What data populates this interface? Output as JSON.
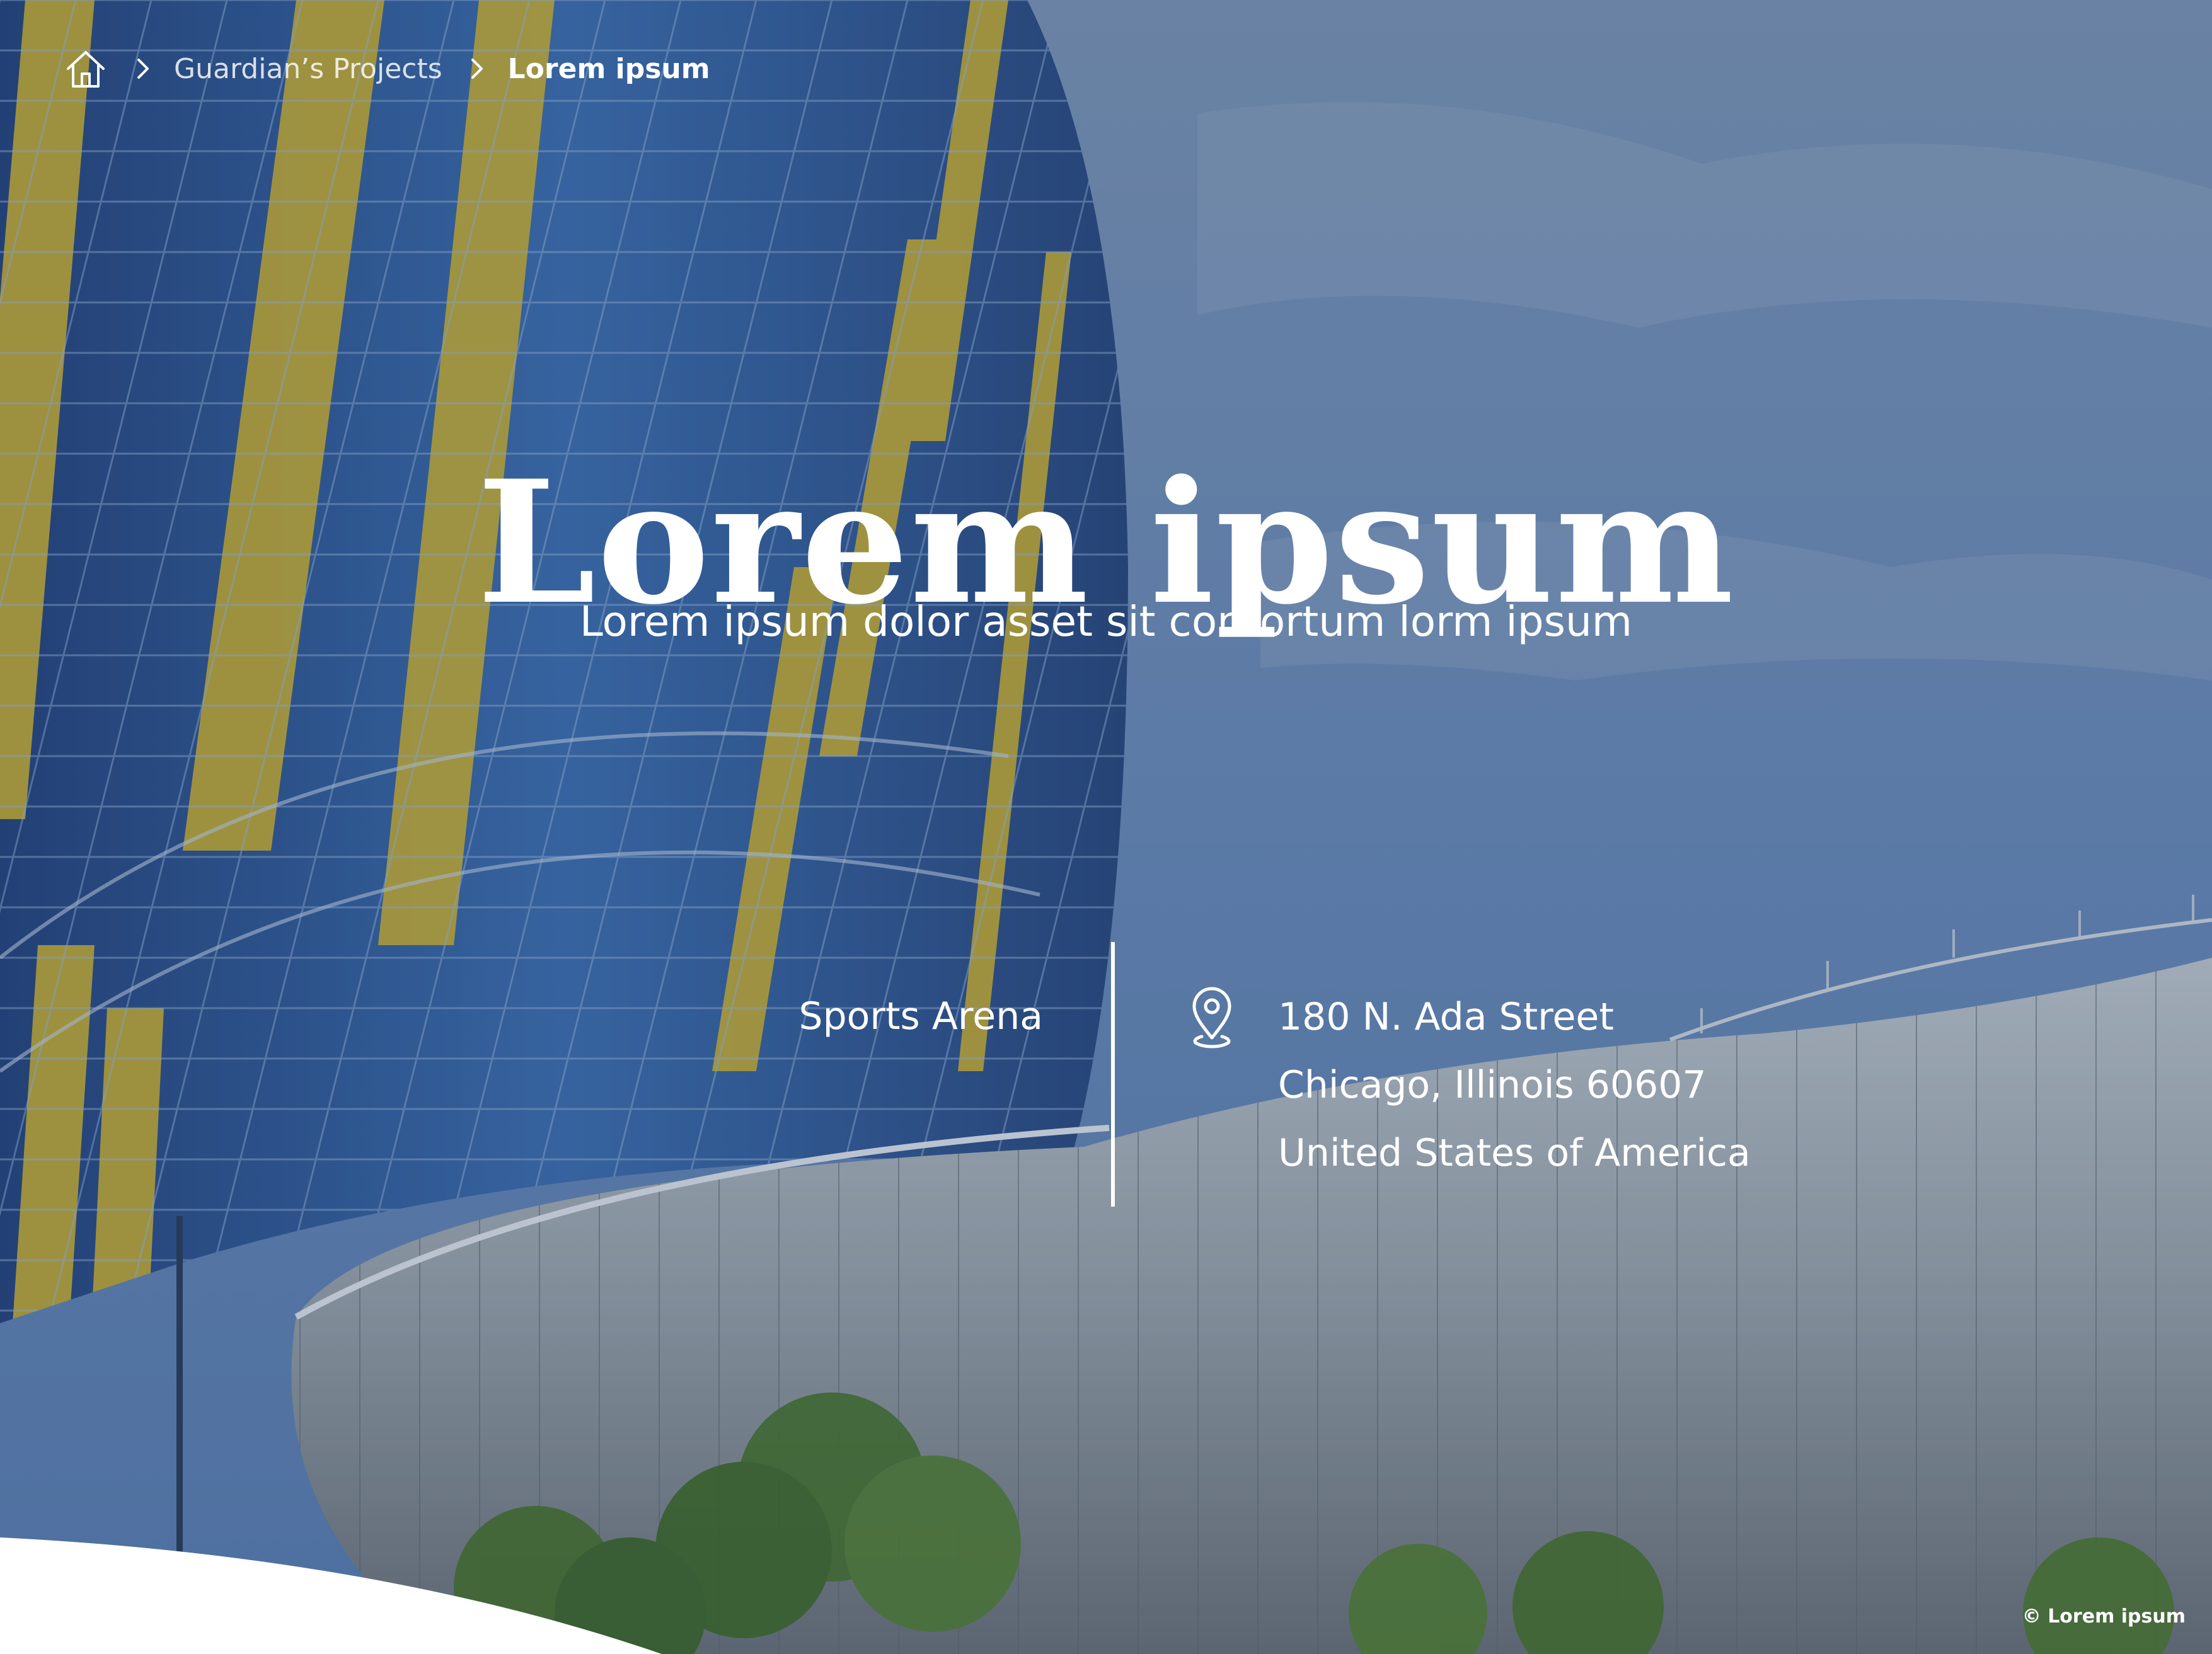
{
  "breadcrumb": {
    "home_icon": "home-icon",
    "separator_icon": "chevron-right-icon",
    "parent_label": "Guardian’s Projects",
    "current_label": "Lorem ipsum"
  },
  "hero": {
    "title": "Lorem ipsum",
    "subtitle": "Lorem ipsum dolor asset sit contortum lorm ipsum"
  },
  "location": {
    "category": "Sports Arena",
    "pin_icon": "location-pin-icon",
    "address_line_1": "180 N. Ada Street",
    "address_line_2": "Chicago, Illinois 60607",
    "address_line_3": "United States of America"
  },
  "footer": {
    "copyright": "© Lorem ipsum"
  },
  "colors": {
    "text": "#ffffff",
    "sky": "#6f8fb7",
    "glass_blue": "#2f4f86",
    "accent_yellow": "#d8b72a",
    "metal_silver": "#a9aeb0",
    "tree_green": "#4f7a2a",
    "overlay": "#1f3a66"
  }
}
